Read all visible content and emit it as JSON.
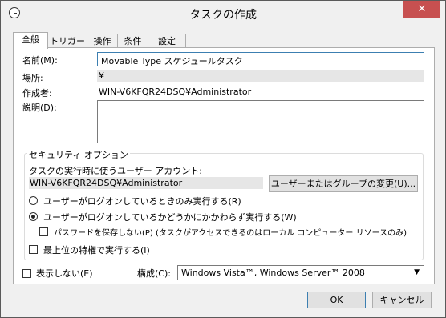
{
  "window": {
    "title": "タスクの作成",
    "close_glyph": "✕"
  },
  "tabs": [
    {
      "label": "全般",
      "active": true
    },
    {
      "label": "トリガー",
      "active": false
    },
    {
      "label": "操作",
      "active": false
    },
    {
      "label": "条件",
      "active": false
    },
    {
      "label": "設定",
      "active": false
    }
  ],
  "general": {
    "name_label": "名前(M):",
    "name_value": "Movable Type スケジュールタスク",
    "location_label": "場所:",
    "location_value": "¥",
    "author_label": "作成者:",
    "author_value": "WIN-V6KFQR24DSQ¥Administrator",
    "description_label": "説明(D):",
    "description_value": ""
  },
  "security": {
    "legend": "セキュリティ オプション",
    "run_as_label": "タスクの実行時に使うユーザー アカウント:",
    "run_as_value": "WIN-V6KFQR24DSQ¥Administrator",
    "change_user_button": "ユーザーまたはグループの変更(U)...",
    "radio_logged_on": "ユーザーがログオンしているときのみ実行する(R)",
    "radio_whether": "ユーザーがログオンしているかどうかにかかわらず実行する(W)",
    "no_store_password": "パスワードを保存しない(P) (タスクがアクセスできるのはローカル コンピューター リソースのみ)",
    "highest_privileges": "最上位の特権で実行する(I)",
    "selected_radio": "whether"
  },
  "bottom": {
    "hidden_label": "表示しない(E)",
    "configure_label": "構成(C):",
    "configure_value": "Windows Vista™, Windows Server™ 2008",
    "ok": "OK",
    "cancel": "キャンセル"
  }
}
